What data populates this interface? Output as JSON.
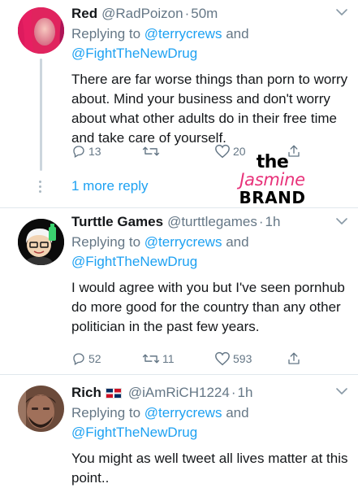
{
  "tweets": [
    {
      "name": "Red",
      "handle": "@RadPoizon",
      "time": "50m",
      "replying_prefix": "Replying to",
      "mention1": "@terrycrews",
      "and": "and",
      "mention2": "@FightTheNewDrug",
      "text": "There are far worse things than porn to worry about. Mind your business and don't worry about what other adults do in their free time and take care of yourself.",
      "replies": "13",
      "retweets": "",
      "likes": "20",
      "more_replies": "1 more reply"
    },
    {
      "name": "Turttle Games",
      "handle": "@turttlegames",
      "time": "1h",
      "replying_prefix": "Replying to",
      "mention1": "@terrycrews",
      "and": "and",
      "mention2": "@FightTheNewDrug",
      "text": "I would agree with you but I've seen pornhub do more good for the country than any other politician in the past few years.",
      "replies": "52",
      "retweets": "11",
      "likes": "593"
    },
    {
      "name": "Rich",
      "flag": "🇩🇴",
      "handle": "@iAmRiCH1224",
      "time": "1h",
      "replying_prefix": "Replying to",
      "mention1": "@terrycrews",
      "and": "and",
      "mention2": "@FightTheNewDrug",
      "text": "You might as well tweet all lives matter at this point.."
    }
  ],
  "watermark": {
    "line1": "the",
    "line2": "Jasmine",
    "line3": "BRAND"
  },
  "colors": {
    "link": "#1da1f2",
    "muted": "#657786",
    "divider": "#e1e8ed",
    "watermark_pink": "#e8327a"
  }
}
